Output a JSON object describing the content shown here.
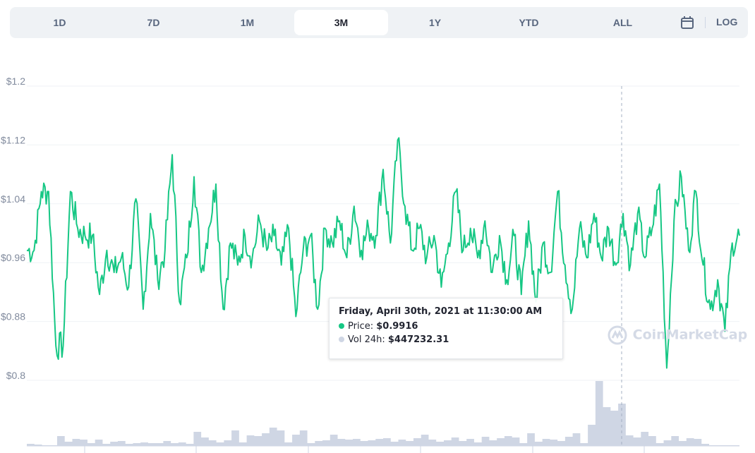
{
  "toolbar": {
    "tabs": [
      {
        "label": "1D"
      },
      {
        "label": "7D"
      },
      {
        "label": "1M"
      },
      {
        "label": "3M"
      },
      {
        "label": "1Y"
      },
      {
        "label": "YTD"
      },
      {
        "label": "ALL"
      }
    ],
    "active": "3M",
    "calendar_icon": "calendar-icon",
    "log_label": "LOG"
  },
  "tooltip": {
    "title": "Friday, April 30th, 2021 at 11:30:00 AM",
    "price_label": "Price:",
    "price_value": "$0.9916",
    "vol_label": "Vol 24h:",
    "vol_value": "$447232.31"
  },
  "watermark": "CoinMarketCap",
  "colors": {
    "price": "#16c784",
    "volume": "#cfd6e4",
    "grid": "#eff2f5"
  },
  "chart_data": {
    "type": "line",
    "ylim": [
      0.8,
      1.2
    ],
    "yticks": [
      "$1.2",
      "$1.12",
      "$1.04",
      "$0.96",
      "$0.88",
      "$0.8"
    ],
    "ytick_values": [
      1.2,
      1.12,
      1.04,
      0.96,
      0.88,
      0.8
    ],
    "grid": true,
    "series": [
      {
        "values": [
          0.97,
          0.97,
          1.05,
          1.05,
          0.84,
          0.84,
          1.05,
          1.0,
          0.99,
          0.99,
          0.91,
          0.97,
          0.94,
          0.96,
          0.92,
          1.04,
          0.89,
          1.02,
          0.93,
          0.97,
          1.1,
          0.9,
          0.96,
          1.07,
          0.94,
          1.0,
          1.06,
          0.89,
          0.98,
          0.95,
          0.99,
          0.96,
          1.01,
          0.97,
          0.99,
          0.95,
          1.0,
          0.88,
          0.97,
          0.99,
          0.89,
          1.0,
          0.98,
          1.01,
          0.96,
          1.03,
          0.97,
          1.0,
          0.99,
          1.08,
          0.98,
          1.12,
          1.03,
          0.97,
          1.0,
          0.96,
          0.99,
          0.92,
          0.98,
          1.05,
          0.97,
          1.0,
          0.96,
          1.01,
          0.94,
          0.99,
          0.93,
          0.99,
          0.91,
          1.01,
          0.9,
          0.98,
          0.94,
          1.05,
          0.95,
          0.89,
          1.0,
          0.96,
          1.02,
          0.96,
          1.0,
          0.95,
          1.02,
          0.95,
          1.02,
          0.96,
          1.0,
          1.06,
          0.81,
          1.01,
          1.07,
          0.97,
          1.05,
          0.95,
          0.89,
          0.93,
          0.86,
          0.98,
          0.99
        ]
      }
    ],
    "volume": [
      3,
      2,
      1,
      1,
      14,
      6,
      10,
      9,
      4,
      9,
      3,
      6,
      7,
      3,
      4,
      5,
      4,
      4,
      7,
      4,
      5,
      3,
      20,
      12,
      8,
      5,
      8,
      22,
      5,
      15,
      14,
      18,
      26,
      22,
      5,
      16,
      22,
      4,
      7,
      8,
      16,
      10,
      9,
      10,
      7,
      8,
      10,
      11,
      6,
      9,
      7,
      11,
      16,
      9,
      6,
      8,
      12,
      7,
      10,
      5,
      13,
      8,
      11,
      14,
      12,
      4,
      18,
      6,
      10,
      9,
      7,
      13,
      18,
      4,
      30,
      92,
      55,
      50,
      60,
      15,
      12,
      20,
      14,
      4,
      8,
      14,
      7,
      11,
      10,
      3,
      1,
      1,
      1,
      1
    ]
  }
}
